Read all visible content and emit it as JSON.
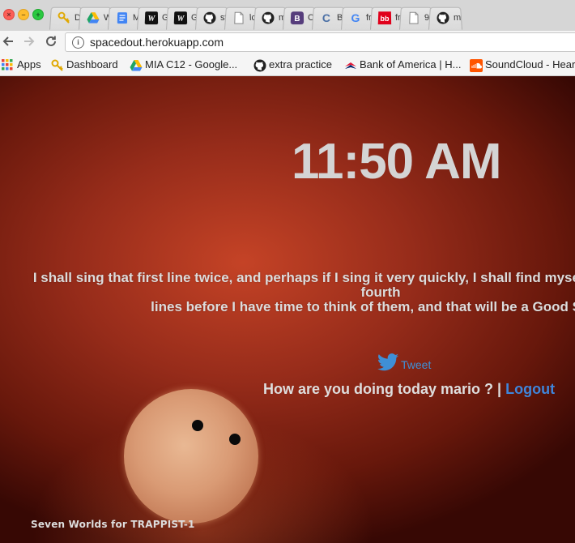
{
  "browser": {
    "tabs": [
      {
        "label": "D",
        "icon": "key-icon",
        "color": "#f5b800"
      },
      {
        "label": "W",
        "icon": "google-drive-icon",
        "color": "#1fa463"
      },
      {
        "label": "M",
        "icon": "google-docs-icon",
        "color": "#4285f4"
      },
      {
        "label": "G",
        "icon": "w-logo-icon",
        "color": "#111111"
      },
      {
        "label": "G",
        "icon": "w-logo-icon",
        "color": "#111111"
      },
      {
        "label": "st",
        "icon": "github-icon",
        "color": "#222222"
      },
      {
        "label": "lc",
        "icon": "page-icon",
        "color": "#888888"
      },
      {
        "label": "m",
        "icon": "github-icon",
        "color": "#222222"
      },
      {
        "label": "C",
        "icon": "bootstrap-icon",
        "color": "#563d7c"
      },
      {
        "label": "B",
        "icon": "c-logo-icon",
        "color": "#4a6fa5"
      },
      {
        "label": "fr",
        "icon": "google-icon",
        "color": "#4285f4"
      },
      {
        "label": "fr",
        "icon": "bb-logo-icon",
        "color": "#e0001b"
      },
      {
        "label": "9",
        "icon": "page-icon",
        "color": "#888888"
      },
      {
        "label": "m",
        "icon": "github-icon",
        "color": "#222222"
      }
    ],
    "url": "spacedout.herokuapp.com",
    "bookmarks": [
      {
        "label": "Apps",
        "icon": "apps-grid-icon"
      },
      {
        "label": "Dashboard",
        "icon": "key-icon"
      },
      {
        "label": "MIA C12 - Google...",
        "icon": "google-drive-icon"
      },
      {
        "label": "extra practice",
        "icon": "github-icon"
      },
      {
        "label": "Bank of America | H...",
        "icon": "bank-of-america-icon"
      },
      {
        "label": "SoundCloud - Hear",
        "icon": "soundcloud-icon"
      }
    ]
  },
  "page": {
    "clock": "11:50 AM",
    "quote_line1": "I shall sing that first line twice, and perhaps if I sing it very quickly, I shall find myself singing the third and fourth",
    "quote_line2": "lines before I have time to think of them, and that will be a Good Song.",
    "tweet_label": "Tweet",
    "greeting": "How are you doing today mario ?",
    "separator": "|",
    "logout_label": "Logout",
    "footer_title": "Seven Worlds for TRAPPIST-1"
  }
}
